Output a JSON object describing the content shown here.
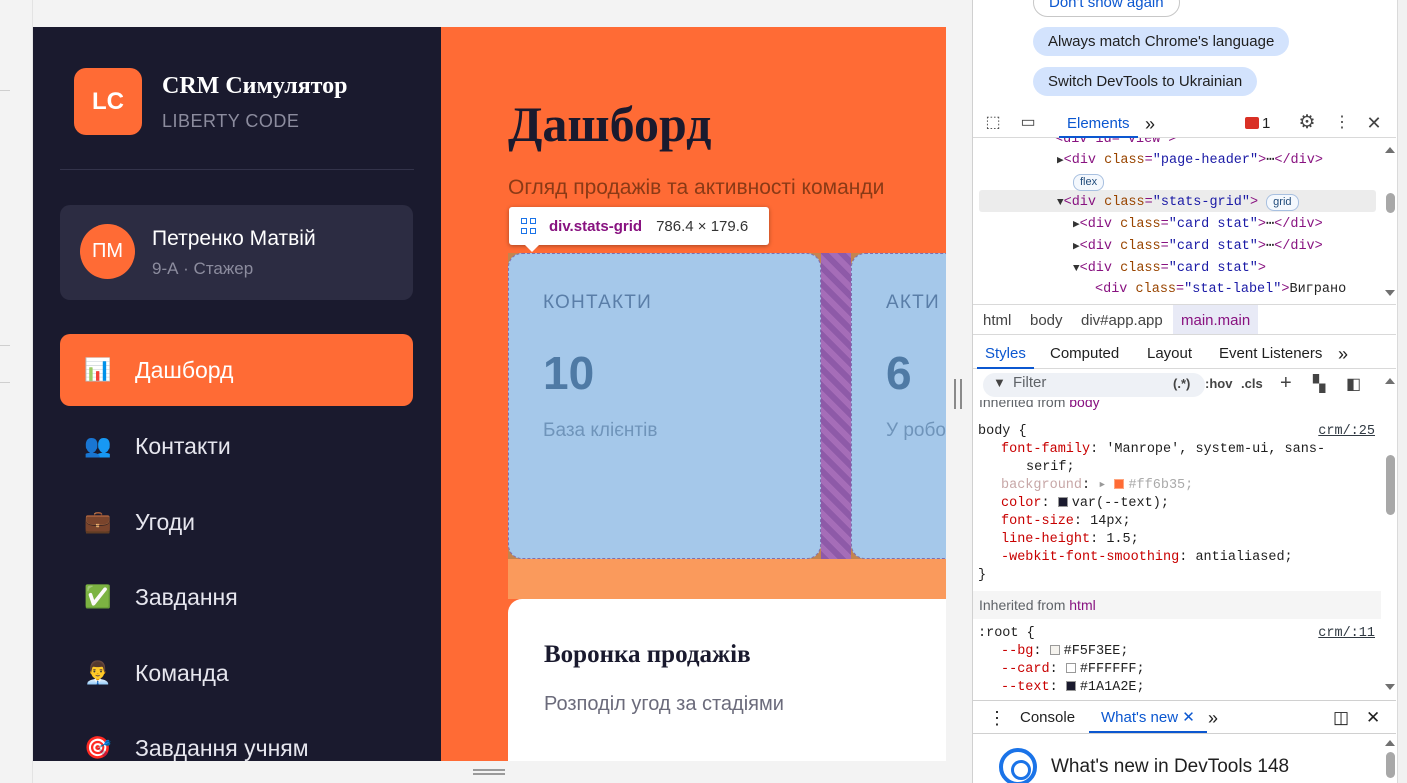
{
  "app": {
    "logo": "LC",
    "name": "CRM Симулятор",
    "subtitle": "LIBERTY CODE"
  },
  "user": {
    "initials": "ПМ",
    "name": "Петренко Матвій",
    "role": "9-А · Стажер"
  },
  "nav": [
    {
      "label": "Дашборд",
      "icon": "📊",
      "active": true
    },
    {
      "label": "Контакти",
      "icon": "👥"
    },
    {
      "label": "Угоди",
      "icon": "💼"
    },
    {
      "label": "Завдання",
      "icon": "✅"
    },
    {
      "label": "Команда",
      "icon": "👨‍💼"
    },
    {
      "label": "Завдання учням",
      "icon": "🎯"
    }
  ],
  "main": {
    "title": "Дашборд",
    "subtitle": "Огляд продажів та активності команди",
    "stats": [
      {
        "label": "КОНТАКТИ",
        "value": "10",
        "note": "База клієнтів"
      },
      {
        "label": "АКТИ",
        "value": "6",
        "note": "У робо"
      }
    ],
    "funnel": {
      "title": "Воронка продажів",
      "subtitle": "Розподіл угод за стадіями"
    }
  },
  "tooltip": {
    "tag": "div.stats-grid",
    "size": "786.4 × 179.6"
  },
  "devtools": {
    "pills": [
      "Don't show again",
      "Always match Chrome's language",
      "Switch DevTools to Ukrainian"
    ],
    "tabs": {
      "elements": "Elements",
      "more": "»",
      "error_count": "1"
    },
    "dom": {
      "line0": "<div id=\"view\">",
      "line1_tag": "div",
      "line1_attr": "class",
      "line1_val": "\"page-header\"",
      "line1_badge": "flex",
      "line2_val": "\"stats-grid\"",
      "line2_badge": "grid",
      "card_val": "\"card stat\"",
      "stat_label_val": "\"stat-label\"",
      "stat_label_text": "Виграно"
    },
    "crumbs": [
      "html",
      "body",
      "div#app.app",
      "main.main"
    ],
    "style_tabs": [
      "Styles",
      "Computed",
      "Layout",
      "Event Listeners",
      "»"
    ],
    "filter": {
      "placeholder": "Filter",
      "hov": ":hov",
      "cls": ".cls",
      "regex": "(.*)"
    },
    "css": {
      "inherited_body": "Inherited from",
      "inherited_body_el": "body",
      "body_selector": "body {",
      "body_src": "crm/:25",
      "body_props": [
        {
          "name": "font-family",
          "value": "'Manrope', system-ui, sans-"
        },
        {
          "name": "",
          "value": "serif;"
        },
        {
          "name": "background",
          "value": "#ff6b35;",
          "swatch": "#ff6b35",
          "dim": true
        },
        {
          "name": "color",
          "value": "var(--text);",
          "swatch": "#1a1a2e"
        },
        {
          "name": "font-size",
          "value": "14px;"
        },
        {
          "name": "line-height",
          "value": "1.5;"
        },
        {
          "name": "-webkit-font-smoothing",
          "value": "antialiased;"
        }
      ],
      "close": "}",
      "inherited_html": "Inherited from",
      "inherited_html_el": "html",
      "root_selector": ":root {",
      "root_src": "crm/:11",
      "root_props": [
        {
          "name": "--bg",
          "value": "#F5F3EE;",
          "swatch": "#F5F3EE"
        },
        {
          "name": "--card",
          "value": "#FFFFFF;",
          "swatch": "#FFFFFF"
        },
        {
          "name": "--text",
          "value": "#1A1A2E;",
          "swatch": "#1A1A2E"
        }
      ]
    },
    "drawer": {
      "console": "Console",
      "whats_new": "What's new",
      "more": "»"
    },
    "whats_new_title": "What's new in DevTools 148"
  }
}
